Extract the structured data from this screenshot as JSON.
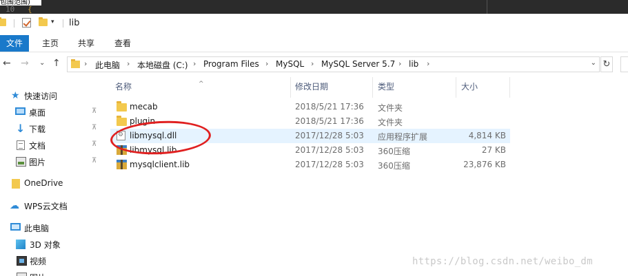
{
  "editor": {
    "scope_text": "包围范围)",
    "line_number": "10",
    "brace": "{"
  },
  "titlebar": {
    "title": "lib",
    "qa_arrow": "▾"
  },
  "ribbon": {
    "tabs": [
      "文件",
      "主页",
      "共享",
      "查看"
    ]
  },
  "nav": {
    "back": "←",
    "forward": "→",
    "recent": "⌄",
    "up": "↑",
    "refresh": "↻",
    "dropdown": "⌄"
  },
  "address": {
    "crumbs": [
      "此电脑",
      "本地磁盘 (C:)",
      "Program Files",
      "MySQL",
      "MySQL Server 5.7",
      "lib"
    ],
    "separator": "›"
  },
  "sidebar": {
    "items": [
      {
        "label": "快速访问",
        "icon": "star-icon",
        "pinned": false
      },
      {
        "label": "桌面",
        "icon": "desktop-icon",
        "pinned": true
      },
      {
        "label": "下载",
        "icon": "download-icon",
        "pinned": true
      },
      {
        "label": "文档",
        "icon": "document-icon",
        "pinned": true
      },
      {
        "label": "图片",
        "icon": "picture-icon",
        "pinned": true
      },
      {
        "label": "OneDrive",
        "icon": "onedrive-icon",
        "pinned": false
      },
      {
        "label": "WPS云文档",
        "icon": "cloud-icon",
        "pinned": false
      },
      {
        "label": "此电脑",
        "icon": "pc-icon",
        "pinned": false
      },
      {
        "label": "3D 对象",
        "icon": "cube-icon",
        "pinned": false
      },
      {
        "label": "视频",
        "icon": "video-icon",
        "pinned": false
      },
      {
        "label": "图片",
        "icon": "picture-icon",
        "pinned": false
      }
    ],
    "pin_glyph": "📌"
  },
  "filelist": {
    "columns": [
      "名称",
      "修改日期",
      "类型",
      "大小"
    ],
    "sort_arrow": "^",
    "rows": [
      {
        "name": "mecab",
        "date": "2018/5/21 17:36",
        "type": "文件夹",
        "size": "",
        "icon": "folder-icon"
      },
      {
        "name": "plugin",
        "date": "2018/5/21 17:36",
        "type": "文件夹",
        "size": "",
        "icon": "folder-icon"
      },
      {
        "name": "libmysql.dll",
        "date": "2017/12/28 5:03",
        "type": "应用程序扩展",
        "size": "4,814 KB",
        "icon": "dll-icon",
        "selected": true
      },
      {
        "name": "libmysql.lib",
        "date": "2017/12/28 5:03",
        "type": "360压缩",
        "size": "27 KB",
        "icon": "archive-icon"
      },
      {
        "name": "mysqlclient.lib",
        "date": "2017/12/28 5:03",
        "type": "360压缩",
        "size": "23,876 KB",
        "icon": "archive-icon"
      }
    ]
  },
  "watermark": "https://blog.csdn.net/weibo_dm",
  "colors": {
    "accent": "#1979ca",
    "selection": "#e5f3ff",
    "folder": "#f3c94e",
    "annotation": "#e02020"
  }
}
